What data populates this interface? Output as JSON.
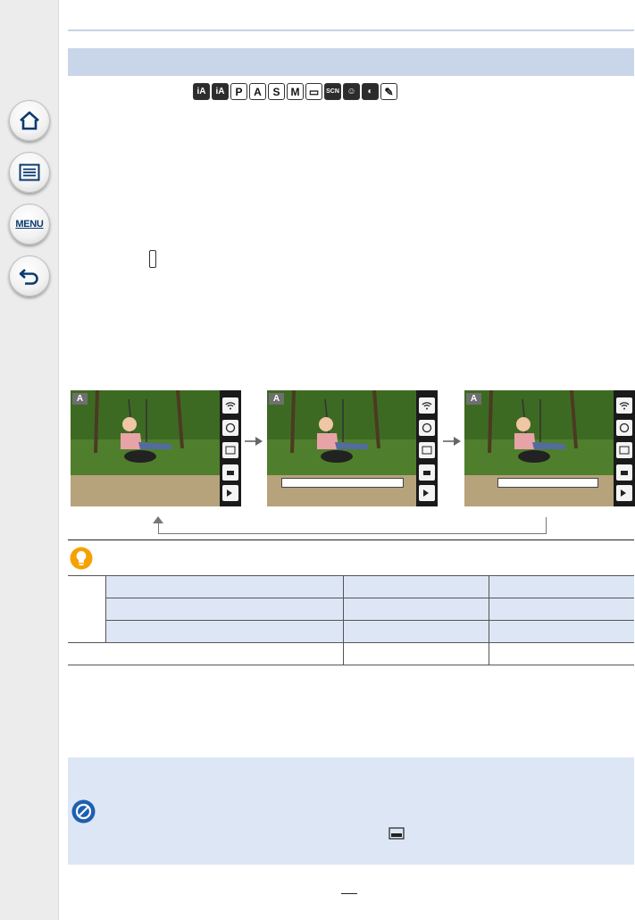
{
  "sidebar": {
    "home_icon": "home-icon",
    "list_icon": "list-icon",
    "menu_label": "MENU",
    "back_icon": "back-arrow-icon",
    "accent": "#0b3a6e"
  },
  "mode_icons": {
    "items": [
      "iA",
      "iA",
      "P",
      "A",
      "S",
      "M",
      "▭",
      "SCN",
      "☺",
      "◐",
      "✎"
    ],
    "border_color": "#333333"
  },
  "screens": {
    "items": [
      {
        "badge": "A"
      },
      {
        "badge": "A"
      },
      {
        "badge": "A"
      }
    ]
  },
  "colors": {
    "title_band": "#c9d6ea",
    "table_shade": "#dde6f4",
    "note_box": "#dde6f4",
    "tip_icon": "#f5a200",
    "no_icon": "#1f5fb3"
  }
}
